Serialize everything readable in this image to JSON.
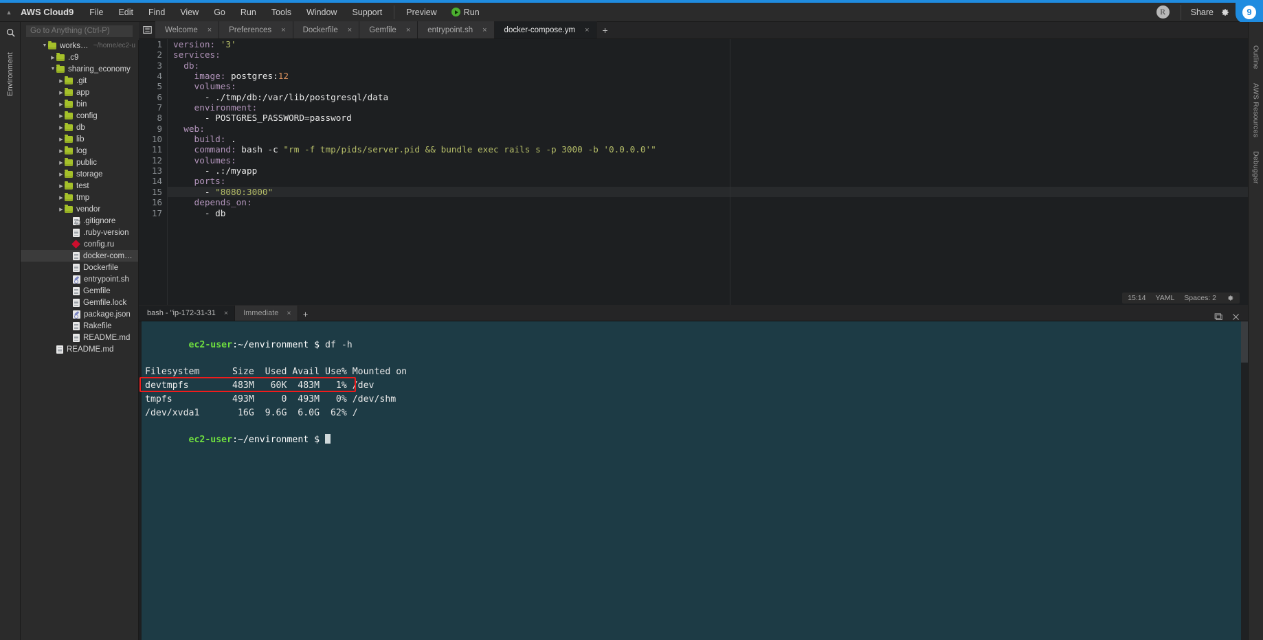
{
  "menubar": {
    "brand": "AWS Cloud9",
    "collapse_icon": "chevron-up-icon",
    "items": [
      "File",
      "Edit",
      "Find",
      "View",
      "Go",
      "Run",
      "Tools",
      "Window",
      "Support"
    ],
    "preview": "Preview",
    "run": "Run",
    "avatar_initial": "R",
    "share": "Share",
    "gear_icon": "gear-icon",
    "logo_text": "9"
  },
  "left_rail": {
    "search_icon": "search-icon",
    "label": "Environment"
  },
  "right_rail": {
    "items": [
      "Outline",
      "AWS Resources",
      "Debugger"
    ]
  },
  "search": {
    "placeholder": "Go to Anything (Ctrl-P)",
    "value": ""
  },
  "filetree": {
    "root": {
      "label": "workspace",
      "path": "~/home/ec2-u",
      "arrow": "▼"
    },
    "nodes": [
      {
        "label": ".c9",
        "type": "folder",
        "depth": 2,
        "arrow": "▶"
      },
      {
        "label": "sharing_economy",
        "type": "folder",
        "depth": 2,
        "arrow": "▼"
      },
      {
        "label": ".git",
        "type": "folder",
        "depth": 3,
        "arrow": "▶"
      },
      {
        "label": "app",
        "type": "folder",
        "depth": 3,
        "arrow": "▶"
      },
      {
        "label": "bin",
        "type": "folder",
        "depth": 3,
        "arrow": "▶"
      },
      {
        "label": "config",
        "type": "folder",
        "depth": 3,
        "arrow": "▶"
      },
      {
        "label": "db",
        "type": "folder",
        "depth": 3,
        "arrow": "▶"
      },
      {
        "label": "lib",
        "type": "folder",
        "depth": 3,
        "arrow": "▶"
      },
      {
        "label": "log",
        "type": "folder",
        "depth": 3,
        "arrow": "▶"
      },
      {
        "label": "public",
        "type": "folder",
        "depth": 3,
        "arrow": "▶"
      },
      {
        "label": "storage",
        "type": "folder",
        "depth": 3,
        "arrow": "▶"
      },
      {
        "label": "test",
        "type": "folder",
        "depth": 3,
        "arrow": "▶"
      },
      {
        "label": "tmp",
        "type": "folder",
        "depth": 3,
        "arrow": "▶"
      },
      {
        "label": "vendor",
        "type": "folder",
        "depth": 3,
        "arrow": "▶"
      },
      {
        "label": ".gitignore",
        "type": "gear-file",
        "depth": 4,
        "arrow": ""
      },
      {
        "label": ".ruby-version",
        "type": "file",
        "depth": 4,
        "arrow": ""
      },
      {
        "label": "config.ru",
        "type": "ruby",
        "depth": 4,
        "arrow": ""
      },
      {
        "label": "docker-compose.yml",
        "type": "file",
        "depth": 4,
        "arrow": "",
        "selected": true
      },
      {
        "label": "Dockerfile",
        "type": "file",
        "depth": 4,
        "arrow": ""
      },
      {
        "label": "entrypoint.sh",
        "type": "script",
        "depth": 4,
        "arrow": ""
      },
      {
        "label": "Gemfile",
        "type": "file",
        "depth": 4,
        "arrow": ""
      },
      {
        "label": "Gemfile.lock",
        "type": "file",
        "depth": 4,
        "arrow": ""
      },
      {
        "label": "package.json",
        "type": "script",
        "depth": 4,
        "arrow": ""
      },
      {
        "label": "Rakefile",
        "type": "file",
        "depth": 4,
        "arrow": ""
      },
      {
        "label": "README.md",
        "type": "file",
        "depth": 4,
        "arrow": ""
      },
      {
        "label": "README.md",
        "type": "file",
        "depth": 2,
        "arrow": ""
      }
    ]
  },
  "editor_tabs": {
    "menu_icon": "tab-list-icon",
    "plus_label": "+",
    "tabs": [
      {
        "label": "Welcome",
        "close": "×",
        "active": false
      },
      {
        "label": "Preferences",
        "close": "×",
        "active": false
      },
      {
        "label": "Dockerfile",
        "close": "×",
        "active": false
      },
      {
        "label": "Gemfile",
        "close": "×",
        "active": false
      },
      {
        "label": "entrypoint.sh",
        "close": "×",
        "active": false
      },
      {
        "label": "docker-compose.ym",
        "close": "×",
        "active": true
      }
    ]
  },
  "code": {
    "language": "YAML",
    "active_line": 15,
    "lines": [
      {
        "n": 1,
        "tokens": [
          {
            "t": "version:",
            "c": "key"
          },
          {
            "t": " ",
            "c": "txt"
          },
          {
            "t": "'3'",
            "c": "str"
          }
        ]
      },
      {
        "n": 2,
        "tokens": [
          {
            "t": "services:",
            "c": "key"
          }
        ]
      },
      {
        "n": 3,
        "tokens": [
          {
            "t": "  db:",
            "c": "key"
          }
        ]
      },
      {
        "n": 4,
        "tokens": [
          {
            "t": "    image:",
            "c": "key"
          },
          {
            "t": " postgres:",
            "c": "txt"
          },
          {
            "t": "12",
            "c": "num"
          }
        ]
      },
      {
        "n": 5,
        "tokens": [
          {
            "t": "    volumes:",
            "c": "key"
          }
        ]
      },
      {
        "n": 6,
        "tokens": [
          {
            "t": "      - ./tmp/db:/var/lib/postgresql/data",
            "c": "txt"
          }
        ]
      },
      {
        "n": 7,
        "tokens": [
          {
            "t": "    environment:",
            "c": "key"
          }
        ]
      },
      {
        "n": 8,
        "tokens": [
          {
            "t": "      - POSTGRES_PASSWORD=password",
            "c": "txt"
          }
        ]
      },
      {
        "n": 9,
        "tokens": [
          {
            "t": "  web:",
            "c": "key"
          }
        ]
      },
      {
        "n": 10,
        "tokens": [
          {
            "t": "    build:",
            "c": "key"
          },
          {
            "t": " .",
            "c": "txt"
          }
        ]
      },
      {
        "n": 11,
        "tokens": [
          {
            "t": "    command:",
            "c": "key"
          },
          {
            "t": " bash -c ",
            "c": "txt"
          },
          {
            "t": "\"rm -f tmp/pids/server.pid && bundle exec rails s -p 3000 -b '0.0.0.0'\"",
            "c": "str"
          }
        ]
      },
      {
        "n": 12,
        "tokens": [
          {
            "t": "    volumes:",
            "c": "key"
          }
        ]
      },
      {
        "n": 13,
        "tokens": [
          {
            "t": "      - .:/myapp",
            "c": "txt"
          }
        ]
      },
      {
        "n": 14,
        "tokens": [
          {
            "t": "    ports:",
            "c": "key"
          }
        ]
      },
      {
        "n": 15,
        "tokens": [
          {
            "t": "      - ",
            "c": "txt"
          },
          {
            "t": "\"8080:3000\"",
            "c": "str"
          }
        ]
      },
      {
        "n": 16,
        "tokens": [
          {
            "t": "    depends_on:",
            "c": "key"
          }
        ]
      },
      {
        "n": 17,
        "tokens": [
          {
            "t": "      - db",
            "c": "txt"
          }
        ]
      }
    ]
  },
  "status": {
    "time": "15:14",
    "language": "YAML",
    "indent": "Spaces: 2",
    "gear_icon": "gear-icon"
  },
  "terminal": {
    "tabs": [
      {
        "label": "bash - \"ip-172-31-31",
        "close": "×",
        "active": true
      },
      {
        "label": "Immediate",
        "close": "×",
        "active": false
      }
    ],
    "plus_label": "+",
    "maximize_icon": "maximize-icon",
    "close_icon": "close-icon",
    "prompt_user": "ec2-user",
    "prompt_path": ":~/environment $ ",
    "command": "df -h",
    "output": [
      "Filesystem      Size  Used Avail Use% Mounted on",
      "devtmpfs        483M   60K  483M   1% /dev",
      "tmpfs           493M     0  493M   0% /dev/shm",
      "/dev/xvda1       16G  9.6G  6.0G  62% /"
    ],
    "highlight": {
      "line_index": 3,
      "color": "#f01c1c",
      "text": "/dev/xvda1       16G  9.6G  6.0G  62% /"
    },
    "final_prompt_user": "ec2-user",
    "final_prompt_path": ":~/environment $ "
  },
  "colors": {
    "accent": "#1f8ce0",
    "terminal_bg": "#1d3b45",
    "editor_bg": "#1d1f21",
    "chrome_bg": "#2b2b2b",
    "highlight_red": "#f01c1c",
    "prompt_green": "#6fdf3f",
    "yaml_key": "#b294bb",
    "yaml_string": "#b5bd68",
    "yaml_number": "#de935f",
    "folder_green": "#a5c12a"
  }
}
